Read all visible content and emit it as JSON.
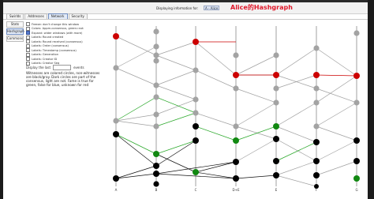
{
  "header": {
    "display_label": "Displaying information for:",
    "member_select": "A - Alice",
    "title": "Alice的Hashgraph"
  },
  "tabs": [
    {
      "label": "Swirlds",
      "active": false
    },
    {
      "label": "Addresses",
      "active": false
    },
    {
      "label": "Network",
      "active": true
    },
    {
      "label": "Security",
      "active": false
    }
  ],
  "sidebar": [
    {
      "label": "Stats",
      "active": false
    },
    {
      "label": "Hashgraph",
      "active": true
    },
    {
      "label": "Commons",
      "active": false
    }
  ],
  "options": [
    {
      "label": "Freeze: don't change this window",
      "checked": false
    },
    {
      "label": "Colors: Appm-consensus, green=not",
      "checked": false
    },
    {
      "label": "Expand: wider windows (with more)",
      "checked": true
    },
    {
      "label": "Labels: Round created",
      "checked": false
    },
    {
      "label": "Labels: Round received (consensus)",
      "checked": false
    },
    {
      "label": "Labels: Order (consensus)",
      "checked": false
    },
    {
      "label": "Labels: Timestamp (consensus)",
      "checked": false
    },
    {
      "label": "Labels: Generation",
      "checked": false
    },
    {
      "label": "Labels: Creator ID",
      "checked": false
    },
    {
      "label": "Labels: Creator Seq",
      "checked": false
    }
  ],
  "display_last": {
    "prefix": "Display the last",
    "value": "",
    "suffix": "events"
  },
  "legend_note": "Witnesses are colored circles, non-witnesses are black/gray. Dark circles are part of the consensus, light are not. Fame is true for green, false for blue, unknown for red",
  "member_labels": [
    "A",
    "B",
    "C",
    "D+E",
    "E",
    "F",
    "G"
  ],
  "colors": {
    "famous_false": "#cc0000",
    "famous_true": "#2aa82a",
    "consensus": "#000000",
    "non_consensus": "#a3a3a3"
  }
}
